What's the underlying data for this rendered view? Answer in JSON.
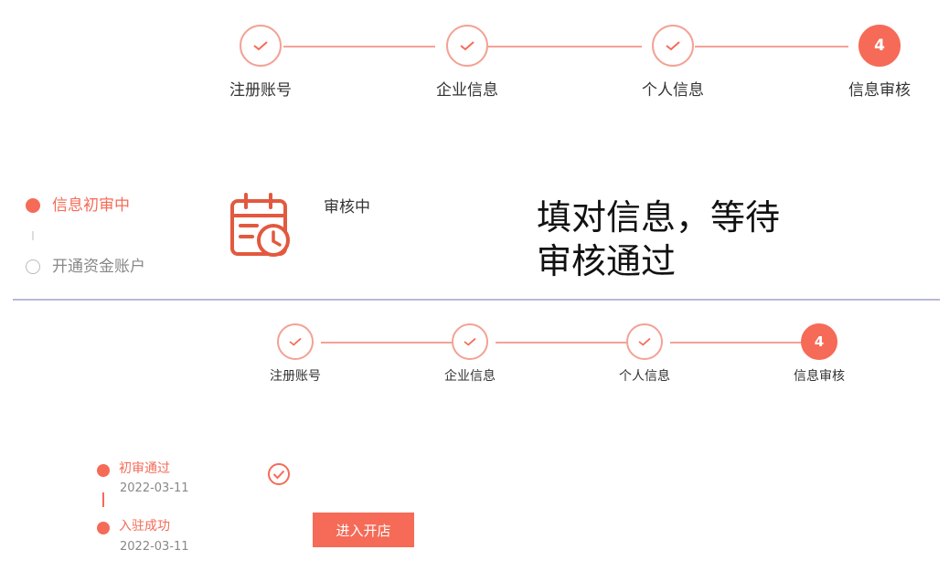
{
  "steps": [
    {
      "label": "注册账号",
      "status": "done"
    },
    {
      "label": "企业信息",
      "status": "done"
    },
    {
      "label": "个人信息",
      "status": "done"
    },
    {
      "label": "信息审核",
      "status": "active",
      "number": "4"
    }
  ],
  "review_timeline": [
    {
      "label": "信息初审中",
      "state": "active"
    },
    {
      "label": "开通资金账户",
      "state": "pending"
    }
  ],
  "review_status": {
    "label": "审核中"
  },
  "overlay_caption": {
    "line1": "填对信息，等待",
    "line2": "审核通过"
  },
  "result_timeline": [
    {
      "label": "初审通过",
      "date": "2022-03-11"
    },
    {
      "label": "入驻成功",
      "date": "2022-03-11"
    }
  ],
  "cta": {
    "label": "进入开店"
  },
  "colors": {
    "accent": "#f56b57",
    "accent_light": "#f3a295",
    "divider": "#b8b9d6",
    "muted": "#888888"
  },
  "icons": {
    "done_step": "check-icon",
    "review": "calendar-clock-icon",
    "result": "check-circle-icon"
  }
}
